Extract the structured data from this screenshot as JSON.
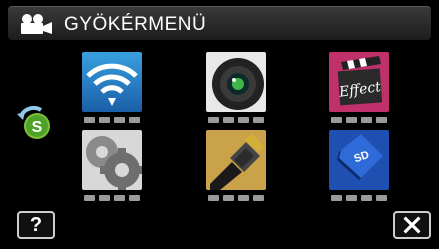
{
  "header": {
    "title": "GYÖKÉRMENÜ",
    "icon": "video-camera-icon"
  },
  "side": {
    "icon": "s-switch-icon"
  },
  "tiles": [
    {
      "icon": "wifi-icon"
    },
    {
      "icon": "camera-lens-icon"
    },
    {
      "icon": "effect-clapper-icon"
    },
    {
      "icon": "settings-gears-icon"
    },
    {
      "icon": "hdmi-connector-icon"
    },
    {
      "icon": "sd-card-icon"
    }
  ],
  "footer": {
    "help_label": "?",
    "close_icon": "close-icon"
  }
}
